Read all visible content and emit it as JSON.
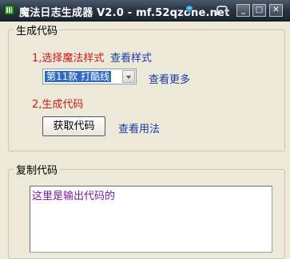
{
  "window": {
    "title": "魔法日志生成器 V2.0 - mf.52qzone.net",
    "controls": {
      "minimize": "_",
      "maximize": "□",
      "close": "✕"
    },
    "icons": [
      "app-icon",
      "gem-icon",
      "ribbon-icon",
      "minimize-icon",
      "maximize-icon",
      "close-icon"
    ]
  },
  "generate_group": {
    "legend": "生成代码",
    "step1_label": "1,选择魔法样式",
    "view_style_link": "查看样式",
    "style_select_value": "第11款 打酷线",
    "view_more_link": "查看更多",
    "step2_label": "2,生成代码",
    "get_code_button": "获取代码",
    "view_usage_link": "查看用法"
  },
  "copy_group": {
    "legend": "复制代码",
    "output_text": "这里是输出代码的"
  },
  "colors": {
    "step_label": "#d01818",
    "link": "#1a3aa8",
    "output_text": "#7a1aa0",
    "selection": "#316ac5"
  }
}
